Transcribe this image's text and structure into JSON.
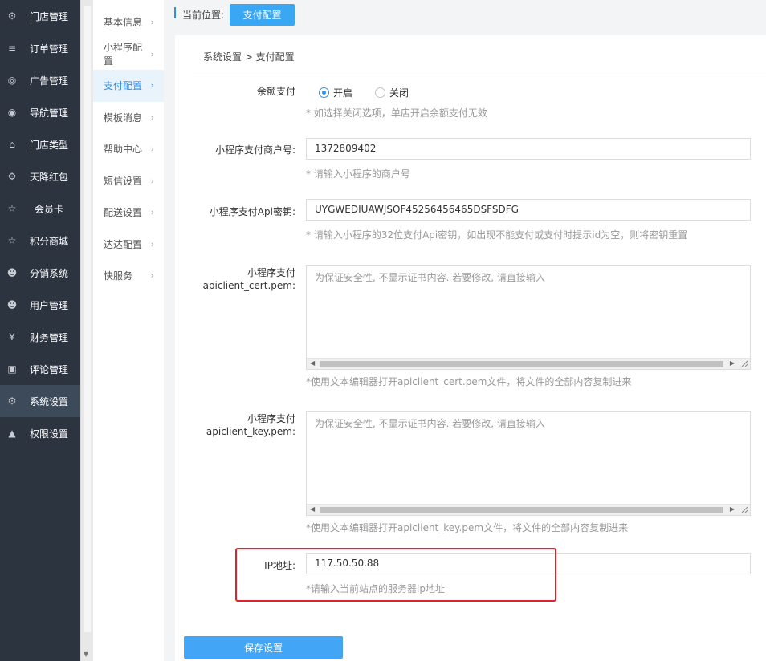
{
  "sidebar": {
    "items": [
      {
        "icon": "store-icon",
        "glyph": "⚙",
        "label": "门店管理"
      },
      {
        "icon": "list-icon",
        "glyph": "≡",
        "label": "订单管理"
      },
      {
        "icon": "lifebuoy-icon",
        "glyph": "◎",
        "label": "广告管理"
      },
      {
        "icon": "compass-icon",
        "glyph": "◉",
        "label": "导航管理"
      },
      {
        "icon": "bank-icon",
        "glyph": "⌂",
        "label": "门店类型"
      },
      {
        "icon": "gift-icon",
        "glyph": "⚙",
        "label": "天降红包"
      },
      {
        "icon": "star-icon",
        "glyph": "☆",
        "label": "会员卡"
      },
      {
        "icon": "star-icon",
        "glyph": "☆",
        "label": "积分商城"
      },
      {
        "icon": "users-icon",
        "glyph": "☻",
        "label": "分销系统"
      },
      {
        "icon": "user-icon",
        "glyph": "☻",
        "label": "用户管理"
      },
      {
        "icon": "yen-icon",
        "glyph": "¥",
        "label": "财务管理"
      },
      {
        "icon": "money-icon",
        "glyph": "▣",
        "label": "评论管理"
      },
      {
        "icon": "gear-icon",
        "glyph": "⚙",
        "label": "系统设置"
      },
      {
        "icon": "lock-icon",
        "glyph": "▲",
        "label": "权限设置"
      }
    ],
    "active_index": 12
  },
  "submenu": {
    "items": [
      {
        "label": "基本信息"
      },
      {
        "label": "小程序配置"
      },
      {
        "label": "支付配置"
      },
      {
        "label": "模板消息"
      },
      {
        "label": "帮助中心"
      },
      {
        "label": "短信设置"
      },
      {
        "label": "配送设置"
      },
      {
        "label": "达达配置"
      },
      {
        "label": "快服务"
      }
    ],
    "active_index": 2
  },
  "topbar": {
    "location_label": "当前位置:",
    "location_button": "支付配置"
  },
  "breadcrumb": "系统设置 > 支付配置",
  "form": {
    "balance_pay": {
      "label": "余额支付",
      "option_on": "开启",
      "option_off": "关闭",
      "selected": "开启",
      "hint": "* 如选择关闭选项，单店开启余额支付无效"
    },
    "merchant_id": {
      "label": "小程序支付商户号:",
      "value": "1372809402",
      "hint": "* 请输入小程序的商户号"
    },
    "api_key": {
      "label": "小程序支付Api密钥:",
      "value": "UYGWEDIUAWJSOF45256456465DSFSDFG",
      "hint": "* 请输入小程序的32位支付Api密钥，如出现不能支付或支付时提示id为空，则将密钥重置"
    },
    "cert": {
      "label_line1": "小程序支付",
      "label_line2": "apiclient_cert.pem:",
      "placeholder": "为保证安全性, 不显示证书内容. 若要修改, 请直接输入",
      "hint": "*使用文本编辑器打开apiclient_cert.pem文件，将文件的全部内容复制进来"
    },
    "key": {
      "label_line1": "小程序支付",
      "label_line2": "apiclient_key.pem:",
      "placeholder": "为保证安全性, 不显示证书内容. 若要修改, 请直接输入",
      "hint": "*使用文本编辑器打开apiclient_key.pem文件，将文件的全部内容复制进来"
    },
    "ip": {
      "label": "IP地址:",
      "value": "117.50.50.88",
      "hint": "*请输入当前站点的服务器ip地址"
    },
    "save_label": "保存设置"
  },
  "colors": {
    "accent": "#3aa7f5",
    "sidebar_bg": "#2c3440",
    "highlight": "#e0232a"
  }
}
